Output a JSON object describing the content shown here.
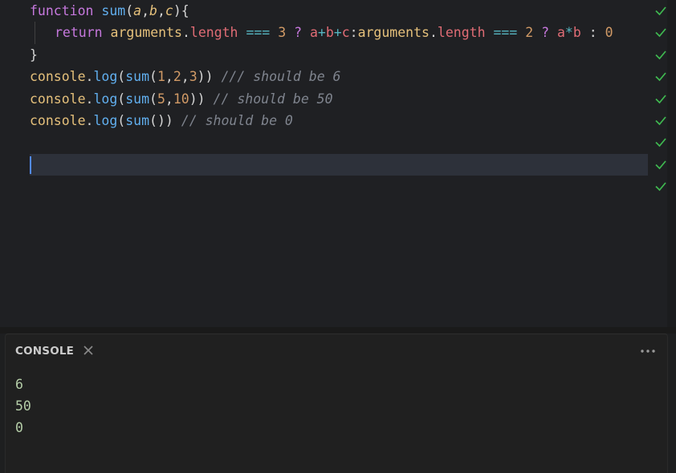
{
  "editor": {
    "lines": [
      {
        "tokens": [
          {
            "t": "function",
            "c": "kw-fn"
          },
          {
            "t": " ",
            "c": "punc"
          },
          {
            "t": "sum",
            "c": "fn"
          },
          {
            "t": "(",
            "c": "punc"
          },
          {
            "t": "a",
            "c": "param"
          },
          {
            "t": ",",
            "c": "punc"
          },
          {
            "t": "b",
            "c": "param"
          },
          {
            "t": ",",
            "c": "punc"
          },
          {
            "t": "c",
            "c": "param"
          },
          {
            "t": "){",
            "c": "punc"
          }
        ]
      },
      {
        "indent": true,
        "tokens": [
          {
            "t": "return",
            "c": "kw"
          },
          {
            "t": " ",
            "c": "punc"
          },
          {
            "t": "arguments",
            "c": "args"
          },
          {
            "t": ".",
            "c": "punc"
          },
          {
            "t": "length",
            "c": "prop"
          },
          {
            "t": " ",
            "c": "punc"
          },
          {
            "t": "===",
            "c": "op"
          },
          {
            "t": " ",
            "c": "punc"
          },
          {
            "t": "3",
            "c": "num"
          },
          {
            "t": " ",
            "c": "punc"
          },
          {
            "t": "?",
            "c": "kw"
          },
          {
            "t": " ",
            "c": "punc"
          },
          {
            "t": "a",
            "c": "var"
          },
          {
            "t": "+",
            "c": "op"
          },
          {
            "t": "b",
            "c": "var"
          },
          {
            "t": "+",
            "c": "op"
          },
          {
            "t": "c",
            "c": "var"
          },
          {
            "t": ":",
            "c": "punc"
          },
          {
            "t": "arguments",
            "c": "args"
          },
          {
            "t": ".",
            "c": "punc"
          },
          {
            "t": "length",
            "c": "prop"
          },
          {
            "t": " ",
            "c": "punc"
          },
          {
            "t": "===",
            "c": "op"
          },
          {
            "t": " ",
            "c": "punc"
          },
          {
            "t": "2",
            "c": "num"
          },
          {
            "t": " ",
            "c": "punc"
          },
          {
            "t": "?",
            "c": "kw"
          },
          {
            "t": " ",
            "c": "punc"
          },
          {
            "t": "a",
            "c": "var"
          },
          {
            "t": "*",
            "c": "op"
          },
          {
            "t": "b",
            "c": "var"
          },
          {
            "t": " ",
            "c": "punc"
          },
          {
            "t": ":",
            "c": "punc"
          },
          {
            "t": " ",
            "c": "punc"
          },
          {
            "t": "0",
            "c": "num"
          }
        ]
      },
      {
        "tokens": [
          {
            "t": "}",
            "c": "punc"
          }
        ]
      },
      {
        "tokens": [
          {
            "t": "console",
            "c": "obj"
          },
          {
            "t": ".",
            "c": "punc"
          },
          {
            "t": "log",
            "c": "fn"
          },
          {
            "t": "(",
            "c": "punc"
          },
          {
            "t": "sum",
            "c": "fn"
          },
          {
            "t": "(",
            "c": "punc"
          },
          {
            "t": "1",
            "c": "num"
          },
          {
            "t": ",",
            "c": "punc"
          },
          {
            "t": "2",
            "c": "num"
          },
          {
            "t": ",",
            "c": "punc"
          },
          {
            "t": "3",
            "c": "num"
          },
          {
            "t": "))",
            "c": "punc"
          },
          {
            "t": " ",
            "c": "punc"
          },
          {
            "t": "/// should be 6",
            "c": "comment"
          }
        ]
      },
      {
        "tokens": [
          {
            "t": "console",
            "c": "obj"
          },
          {
            "t": ".",
            "c": "punc"
          },
          {
            "t": "log",
            "c": "fn"
          },
          {
            "t": "(",
            "c": "punc"
          },
          {
            "t": "sum",
            "c": "fn"
          },
          {
            "t": "(",
            "c": "punc"
          },
          {
            "t": "5",
            "c": "num"
          },
          {
            "t": ",",
            "c": "punc"
          },
          {
            "t": "10",
            "c": "num"
          },
          {
            "t": "))",
            "c": "punc"
          },
          {
            "t": " ",
            "c": "punc"
          },
          {
            "t": "// should be 50",
            "c": "comment"
          }
        ]
      },
      {
        "tokens": [
          {
            "t": "console",
            "c": "obj"
          },
          {
            "t": ".",
            "c": "punc"
          },
          {
            "t": "log",
            "c": "fn"
          },
          {
            "t": "(",
            "c": "punc"
          },
          {
            "t": "sum",
            "c": "fn"
          },
          {
            "t": "())",
            "c": "punc"
          },
          {
            "t": " ",
            "c": "punc"
          },
          {
            "t": "// should be 0",
            "c": "comment"
          }
        ]
      },
      {
        "tokens": []
      },
      {
        "active": true,
        "cursor": true,
        "tokens": []
      }
    ],
    "gutter_checks": 9,
    "check_color": "#3fb950"
  },
  "console": {
    "title": "CONSOLE",
    "close_icon": "close-icon",
    "more_icon": "more-horizontal-icon",
    "output": [
      "6",
      "50",
      "0"
    ]
  }
}
